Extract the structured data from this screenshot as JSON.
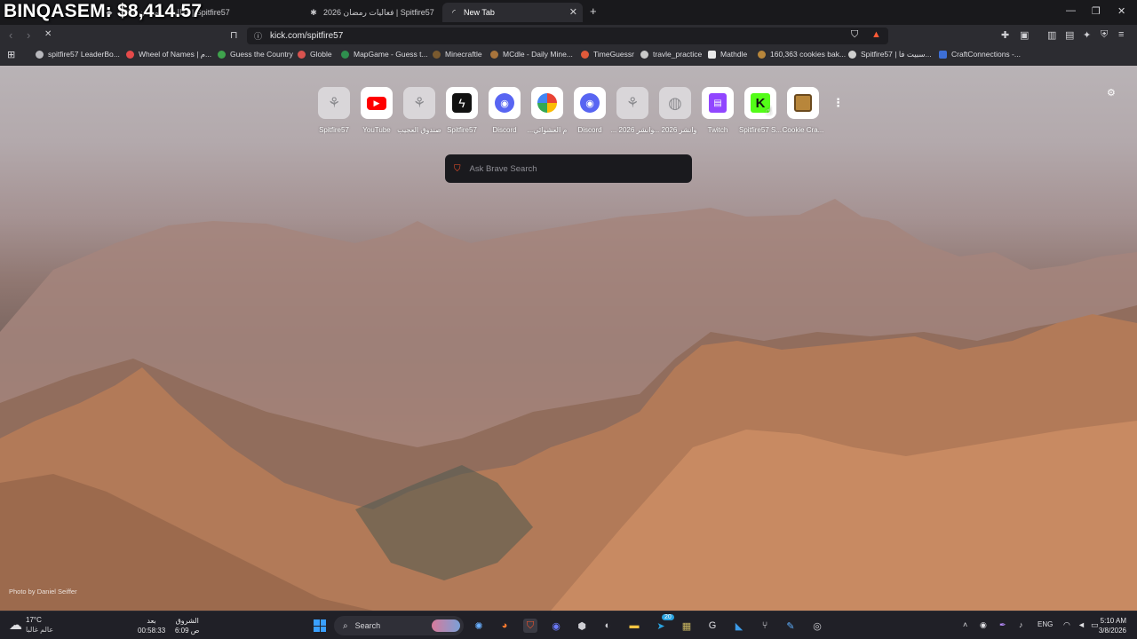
{
  "overlay": {
    "text": "BINQASEM: $8,414.57"
  },
  "tabs": [
    {
      "label": "فعاليات رمضان 2026 | Spitfire57",
      "active": false
    },
    {
      "label": "فعاليات رمضان 2026 | Spitfire57",
      "active": false
    },
    {
      "label": "New Tab",
      "active": true
    }
  ],
  "toolbar": {
    "url": "kick.com/spitfire57"
  },
  "bookmarks": [
    {
      "label": "spitfire57 LeaderBo...",
      "color": "#b8b8bd"
    },
    {
      "label": "Wheel of Names | م...",
      "color": "#e54a4a"
    },
    {
      "label": "Guess the Country",
      "color": "#3fa34d"
    },
    {
      "label": "Globle",
      "color": "#d9534f"
    },
    {
      "label": "MapGame - Guess t...",
      "color": "#2f8f4e"
    },
    {
      "label": "Minecraftle",
      "color": "#7a5a2f"
    },
    {
      "label": "MCdle - Daily Mine...",
      "color": "#a8743c"
    },
    {
      "label": "TimeGuessr",
      "color": "#e05a3a"
    },
    {
      "label": "travle_practice",
      "color": "#c9c9c9"
    },
    {
      "label": "Mathdle",
      "color": "#e8e8e8"
    },
    {
      "label": "160,363 cookies bak...",
      "color": "#b8863b"
    },
    {
      "label": "Spitfire57 | سبيت فا...",
      "color": "#cfcfcf"
    },
    {
      "label": "CraftConnections -...",
      "color": "#3d6fd6"
    }
  ],
  "tiles": [
    {
      "label": "Spitfire57",
      "icon": "spitfire-icon",
      "bg": "#d9d6d9",
      "glyph": "⚘",
      "fg": "#8a8a8e"
    },
    {
      "label": "YouTube",
      "icon": "youtube-icon",
      "bg": "#ffffff",
      "glyph": "▶",
      "fg": "#ff0000"
    },
    {
      "label": "صندوق العجيب",
      "icon": "spitfire-icon",
      "bg": "#d9d6d9",
      "glyph": "⚘",
      "fg": "#8a8a8e"
    },
    {
      "label": "Spitfire57",
      "icon": "bolt-icon",
      "bg": "#111111",
      "glyph": "ϟ",
      "fg": "#ffffff"
    },
    {
      "label": "Discord",
      "icon": "discord-icon",
      "bg": "#ffffff",
      "glyph": "◉",
      "fg": "#5865f2"
    },
    {
      "label": "...م العشوائي",
      "icon": "color-wheel-icon",
      "bg": "#ffffff",
      "glyph": "✿",
      "fg": "#e0892f"
    },
    {
      "label": "Discord",
      "icon": "discord-icon",
      "bg": "#ffffff",
      "glyph": "◉",
      "fg": "#5865f2"
    },
    {
      "label": "... وانشر 2026",
      "icon": "spitfire-icon",
      "bg": "#d9d6d9",
      "glyph": "⚘",
      "fg": "#8a8a8e"
    },
    {
      "label": "... وانشر 2026",
      "icon": "globe-icon",
      "bg": "#d9d6d9",
      "glyph": "◍",
      "fg": "#8a8a8e"
    },
    {
      "label": "Twitch",
      "icon": "twitch-icon",
      "bg": "#ffffff",
      "glyph": "▤",
      "fg": "#9146ff"
    },
    {
      "label": "Spitfire57 S...",
      "icon": "kick-icon",
      "bg": "#53fc18",
      "glyph": "K",
      "fg": "#111111"
    },
    {
      "label": "Cookie Cra...",
      "icon": "cookie-icon",
      "bg": "#ffffff",
      "glyph": "▦",
      "fg": "#b8863b"
    }
  ],
  "search": {
    "placeholder": "Ask Brave Search"
  },
  "photo_credit": "Photo by Daniel Seiffer",
  "taskbar": {
    "weather_temp": "17°C",
    "weather_text": "عالم غالبا",
    "sunrise_label": "الشروق",
    "sunrise_time": "6:09 ص",
    "after_label": "بعد",
    "countdown": "00:58:33",
    "search_label": "Search",
    "badge_telegram": "20",
    "lang": "ENG",
    "time": "5:10 AM",
    "date": "3/8/2026"
  }
}
